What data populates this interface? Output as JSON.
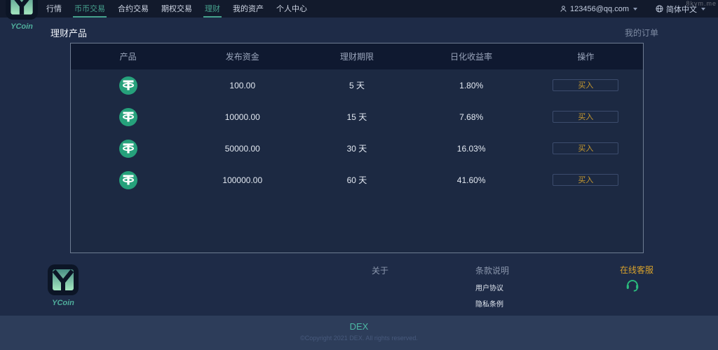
{
  "watermark": "8kym.me",
  "brand": {
    "name": "YCoin",
    "footer_name": "YCoin"
  },
  "navbar": {
    "items": [
      {
        "label": "行情",
        "active": false
      },
      {
        "label": "币币交易",
        "active": true
      },
      {
        "label": "合约交易",
        "active": false
      },
      {
        "label": "期权交易",
        "active": false
      },
      {
        "label": "理财",
        "active": true
      },
      {
        "label": "我的资产",
        "active": false
      },
      {
        "label": "个人中心",
        "active": false
      }
    ],
    "user_email": "123456@qq.com",
    "language": "简体中文"
  },
  "page": {
    "title": "理财产品",
    "orders_link": "我的订单"
  },
  "table": {
    "headers": [
      "产品",
      "发布资金",
      "理财期限",
      "日化收益率",
      "操作"
    ],
    "buy_label": "买入",
    "rows": [
      {
        "amount": "100.00",
        "term": "5 天",
        "rate": "1.80%"
      },
      {
        "amount": "10000.00",
        "term": "15 天",
        "rate": "7.68%"
      },
      {
        "amount": "50000.00",
        "term": "30 天",
        "rate": "16.03%"
      },
      {
        "amount": "100000.00",
        "term": "60 天",
        "rate": "41.60%"
      }
    ]
  },
  "footer": {
    "about_title": "关于",
    "terms_title": "条款说明",
    "links": [
      {
        "label": "用户协议"
      },
      {
        "label": "隐私条例"
      }
    ],
    "support_label": "在线客服"
  },
  "bottom": {
    "title": "DEX",
    "copyright": "©Copyright 2021 DEX. All rights reserved."
  },
  "colors": {
    "accent_teal": "#46a18d",
    "accent_orange": "#c7992f",
    "usdt_green": "#26a17b",
    "support_green": "#2bbd7e"
  }
}
